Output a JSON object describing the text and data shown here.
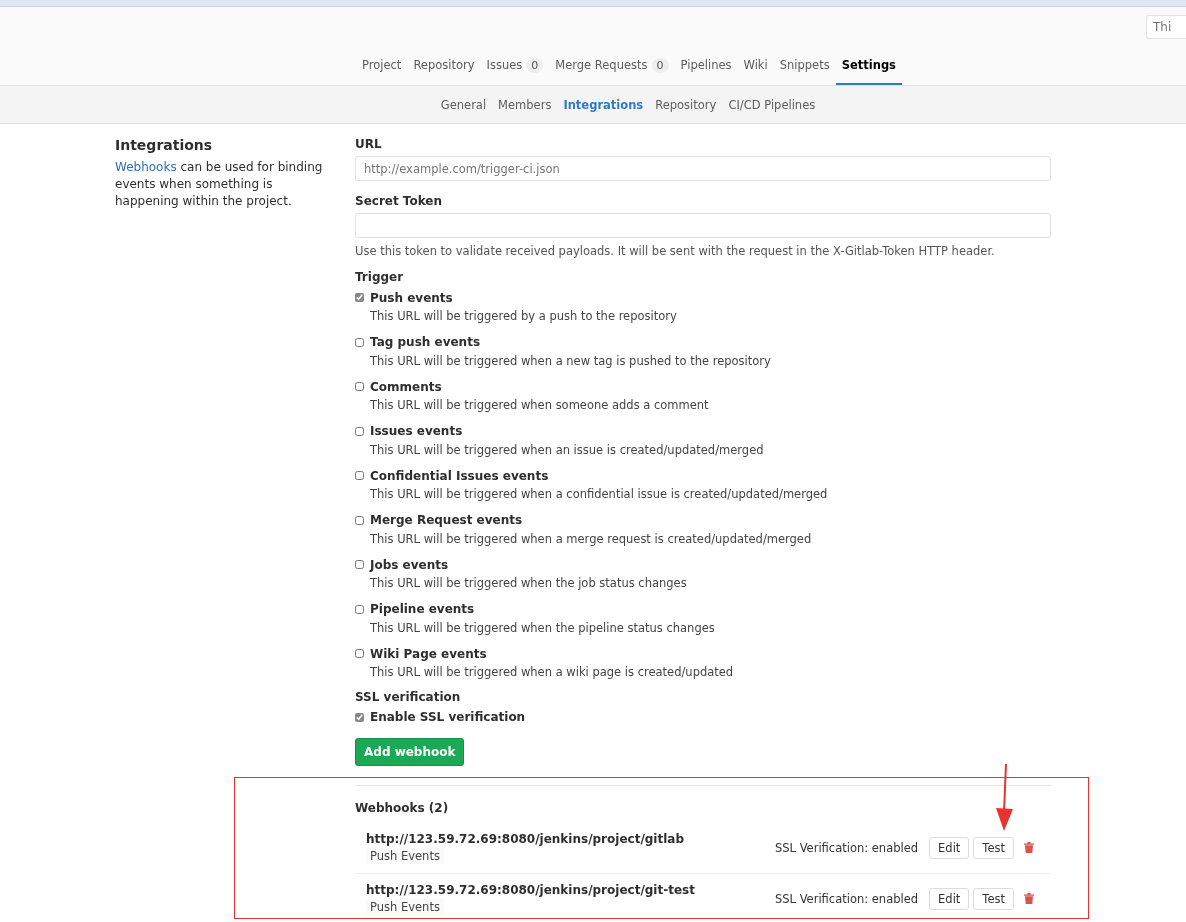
{
  "search": {
    "placeholder": "Thi"
  },
  "nav_tabs": [
    {
      "label": "Project",
      "selected": false
    },
    {
      "label": "Repository",
      "selected": false
    },
    {
      "label": "Issues",
      "count": "0",
      "selected": false
    },
    {
      "label": "Merge Requests",
      "count": "0",
      "selected": false
    },
    {
      "label": "Pipelines",
      "selected": false
    },
    {
      "label": "Wiki",
      "selected": false
    },
    {
      "label": "Snippets",
      "selected": false
    },
    {
      "label": "Settings",
      "selected": true
    }
  ],
  "sub_tabs": [
    {
      "label": "General",
      "selected": false
    },
    {
      "label": "Members",
      "selected": false
    },
    {
      "label": "Integrations",
      "selected": true
    },
    {
      "label": "Repository",
      "selected": false
    },
    {
      "label": "CI/CD Pipelines",
      "selected": false
    }
  ],
  "sidebar": {
    "title": "Integrations",
    "link": "Webhooks",
    "text": "can be used for binding events when something is happening within the project."
  },
  "form": {
    "url_label": "URL",
    "url_placeholder": "http://example.com/trigger-ci.json",
    "token_label": "Secret Token",
    "token_help": "Use this token to validate received payloads. It will be sent with the request in the X-Gitlab-Token HTTP header.",
    "trigger_label": "Trigger",
    "triggers": [
      {
        "label": "Push events",
        "help": "This URL will be triggered by a push to the repository",
        "checked": true
      },
      {
        "label": "Tag push events",
        "help": "This URL will be triggered when a new tag is pushed to the repository",
        "checked": false
      },
      {
        "label": "Comments",
        "help": "This URL will be triggered when someone adds a comment",
        "checked": false
      },
      {
        "label": "Issues events",
        "help": "This URL will be triggered when an issue is created/updated/merged",
        "checked": false
      },
      {
        "label": "Confidential Issues events",
        "help": "This URL will be triggered when a confidential issue is created/updated/merged",
        "checked": false
      },
      {
        "label": "Merge Request events",
        "help": "This URL will be triggered when a merge request is created/updated/merged",
        "checked": false
      },
      {
        "label": "Jobs events",
        "help": "This URL will be triggered when the job status changes",
        "checked": false
      },
      {
        "label": "Pipeline events",
        "help": "This URL will be triggered when the pipeline status changes",
        "checked": false
      },
      {
        "label": "Wiki Page events",
        "help": "This URL will be triggered when a wiki page is created/updated",
        "checked": false
      }
    ],
    "ssl_label": "SSL verification",
    "ssl_option": {
      "label": "Enable SSL verification",
      "checked": true
    },
    "submit": "Add webhook"
  },
  "webhooks": {
    "title": "Webhooks (2)",
    "items": [
      {
        "url": "http://123.59.72.69:8080/jenkins/project/gitlab",
        "event": "Push Events",
        "ssl": "SSL Verification: enabled",
        "edit": "Edit",
        "test": "Test"
      },
      {
        "url": "http://123.59.72.69:8080/jenkins/project/git-test",
        "event": "Push Events",
        "ssl": "SSL Verification: enabled",
        "edit": "Edit",
        "test": "Test"
      }
    ]
  }
}
